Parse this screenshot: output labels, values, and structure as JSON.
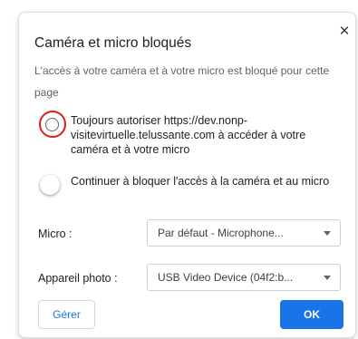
{
  "dialog": {
    "title": "Caméra et micro bloqués",
    "description": "L'accès à votre caméra et à votre micro est bloqué pour cette page",
    "close_icon": "close-icon",
    "options": [
      {
        "label": "Toujours autoriser https://dev.nonp-visitevirtuelle.telussante.com à accéder à votre caméra et à votre micro",
        "selected": false,
        "highlighted": true
      },
      {
        "label": "Continuer à bloquer l'accès à la caméra et au micro",
        "selected": true
      }
    ],
    "micro": {
      "label": "Micro :",
      "value": "Par défaut - Microphone..."
    },
    "camera": {
      "label": "Appareil photo :",
      "value": "USB Video Device (04f2:b..."
    },
    "buttons": {
      "manage": "Gérer",
      "ok": "OK"
    }
  },
  "colors": {
    "accent": "#1a73e8",
    "highlight_ring": "#e21b1b",
    "text": "#202124",
    "muted": "#5f6368"
  }
}
